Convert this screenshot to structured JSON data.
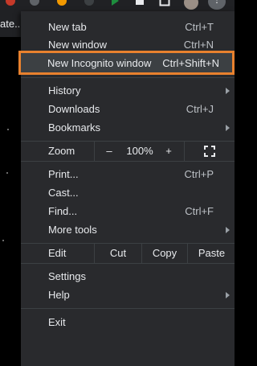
{
  "browser": {
    "tab_title": "ate...",
    "profile_avatar": "avatar",
    "menu_button_glyph": "⋮"
  },
  "menu": {
    "new_tab": {
      "label": "New tab",
      "shortcut": "Ctrl+T"
    },
    "new_window": {
      "label": "New window",
      "shortcut": "Ctrl+N"
    },
    "new_incognito": {
      "label": "New Incognito window",
      "shortcut": "Ctrl+Shift+N"
    },
    "history": {
      "label": "History"
    },
    "downloads": {
      "label": "Downloads",
      "shortcut": "Ctrl+J"
    },
    "bookmarks": {
      "label": "Bookmarks"
    },
    "zoom": {
      "label": "Zoom",
      "minus": "–",
      "value": "100%",
      "plus": "+"
    },
    "print": {
      "label": "Print...",
      "shortcut": "Ctrl+P"
    },
    "cast": {
      "label": "Cast..."
    },
    "find": {
      "label": "Find...",
      "shortcut": "Ctrl+F"
    },
    "more_tools": {
      "label": "More tools"
    },
    "edit": {
      "label": "Edit",
      "cut": "Cut",
      "copy": "Copy",
      "paste": "Paste"
    },
    "settings": {
      "label": "Settings"
    },
    "help": {
      "label": "Help"
    },
    "exit": {
      "label": "Exit"
    }
  },
  "colors": {
    "menu_bg": "#292a2d",
    "separator": "#3c4043",
    "highlight_bg": "#3c4043",
    "callout_border": "#e8812e",
    "text": "#e8eaed",
    "shortcut_text": "#bdc1c6"
  }
}
